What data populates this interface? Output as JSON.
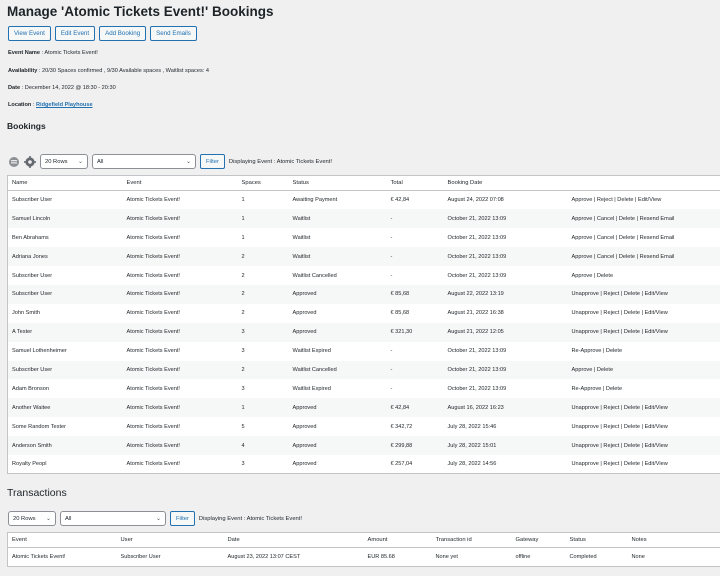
{
  "page_title": "Manage 'Atomic Tickets Event!' Bookings",
  "actions": [
    "View Event",
    "Edit Event",
    "Add Booking",
    "Send Emails"
  ],
  "meta": {
    "event_name_label": "Event Name",
    "event_name": "Atomic Tickets Event!",
    "availability_label": "Availability",
    "availability": "20/30 Spaces confirmed , 9/30 Available spaces , Waitlist spaces: 4",
    "date_label": "Date",
    "date": "December 14, 2022 @ 18:30 - 20:30",
    "location_label": "Location",
    "location": "Ridgefield Playhouse"
  },
  "bookings": {
    "title": "Bookings",
    "rows_select": "20 Rows",
    "filter_select": "All",
    "filter_button": "Filter",
    "displaying": "Displaying Event : Atomic Tickets Event!",
    "columns": [
      "Name",
      "Event",
      "Spaces",
      "Status",
      "Total",
      "Booking Date",
      ""
    ],
    "rows": [
      {
        "name": "Subscriber User",
        "name_link": true,
        "event": "Atomic Tickets Event!",
        "spaces": "1",
        "status": "Awaiting Payment",
        "total": "€ 42,84",
        "date": "August 24, 2022 07:08",
        "actions": "Approve | Reject | Delete | Edit/View"
      },
      {
        "name": "Samuel Lincoln",
        "name_link": false,
        "event": "Atomic Tickets Event!",
        "spaces": "1",
        "status": "Waitlist",
        "total": "-",
        "date": "October 21, 2022 13:09",
        "actions": "Approve | Cancel | Delete | Resend Email"
      },
      {
        "name": "Ben Abrahams",
        "name_link": false,
        "event": "Atomic Tickets Event!",
        "spaces": "1",
        "status": "Waitlist",
        "total": "-",
        "date": "October 21, 2022 13:09",
        "actions": "Approve | Cancel | Delete | Resend Email"
      },
      {
        "name": "Adriana Jones",
        "name_link": false,
        "event": "Atomic Tickets Event!",
        "spaces": "2",
        "status": "Waitlist",
        "total": "-",
        "date": "October 21, 2022 13:09",
        "actions": "Approve | Cancel | Delete | Resend Email"
      },
      {
        "name": "Subscriber User",
        "name_link": true,
        "event": "Atomic Tickets Event!",
        "spaces": "2",
        "status": "Waitlist Cancelled",
        "total": "-",
        "date": "October 21, 2022 13:09",
        "actions": "Approve | Delete"
      },
      {
        "name": "Subscriber User",
        "name_link": true,
        "event": "Atomic Tickets Event!",
        "spaces": "2",
        "status": "Approved",
        "total": "€ 85,68",
        "date": "August 22, 2022 13:19",
        "actions": "Unapprove | Reject | Delete | Edit/View"
      },
      {
        "name": "John Smith",
        "name_link": true,
        "event": "Atomic Tickets Event!",
        "spaces": "2",
        "status": "Approved",
        "total": "€ 85,68",
        "date": "August 21, 2022 16:38",
        "actions": "Unapprove | Reject | Delete | Edit/View"
      },
      {
        "name": "A Tester",
        "name_link": true,
        "event": "Atomic Tickets Event!",
        "spaces": "3",
        "status": "Approved",
        "total": "€ 321,30",
        "date": "August 21, 2022 12:05",
        "actions": "Unapprove | Reject | Delete | Edit/View"
      },
      {
        "name": "Samuel Lothenheimer",
        "name_link": false,
        "event": "Atomic Tickets Event!",
        "spaces": "3",
        "status": "Waitlist Expired",
        "total": "-",
        "date": "October 21, 2022 13:09",
        "actions": "Re-Approve | Delete"
      },
      {
        "name": "Subscriber User",
        "name_link": true,
        "event": "Atomic Tickets Event!",
        "spaces": "2",
        "status": "Waitlist Cancelled",
        "total": "-",
        "date": "October 21, 2022 13:09",
        "actions": "Approve | Delete"
      },
      {
        "name": "Adam Bronson",
        "name_link": false,
        "event": "Atomic Tickets Event!",
        "spaces": "3",
        "status": "Waitlist Expired",
        "total": "-",
        "date": "October 21, 2022 13:09",
        "actions": "Re-Approve | Delete"
      },
      {
        "name": "Another Waitee",
        "name_link": false,
        "event": "Atomic Tickets Event!",
        "spaces": "1",
        "status": "Approved",
        "total": "€ 42,84",
        "date": "August 16, 2022 16:23",
        "actions": "Unapprove | Reject | Delete | Edit/View"
      },
      {
        "name": "Some Random Tester",
        "name_link": false,
        "event": "Atomic Tickets Event!",
        "spaces": "5",
        "status": "Approved",
        "total": "€ 342,72",
        "date": "July 28, 2022 15:46",
        "actions": "Unapprove | Reject | Delete | Edit/View"
      },
      {
        "name": "Anderson Smith",
        "name_link": true,
        "event": "Atomic Tickets Event!",
        "spaces": "4",
        "status": "Approved",
        "total": "€ 299,88",
        "date": "July 28, 2022 15:01",
        "actions": "Unapprove | Reject | Delete | Edit/View"
      },
      {
        "name": "Royalty Peopl",
        "name_link": false,
        "event": "Atomic Tickets Event!",
        "spaces": "3",
        "status": "Approved",
        "total": "€ 257,04",
        "date": "July 28, 2022 14:56",
        "actions": "Unapprove | Reject | Delete | Edit/View"
      }
    ]
  },
  "transactions": {
    "title": "Transactions",
    "rows_select": "20 Rows",
    "filter_select": "All",
    "filter_button": "Filter",
    "displaying": "Displaying Event : Atomic Tickets Event!",
    "columns": [
      "Event",
      "User",
      "Date",
      "Amount",
      "Transaction id",
      "Gateway",
      "Status",
      "Notes"
    ],
    "rows": [
      {
        "event": "Atomic Tickets Event!",
        "user": "Subscriber User",
        "date": "August 23, 2022 13:07 CEST",
        "amount": "EUR 85.68",
        "transaction_id": "None yet",
        "gateway": "offline",
        "status": "Completed",
        "notes": "None"
      }
    ]
  },
  "colors": {
    "link": "#2271b1",
    "border": "#c3c4c7",
    "background": "#f0f0f1"
  }
}
